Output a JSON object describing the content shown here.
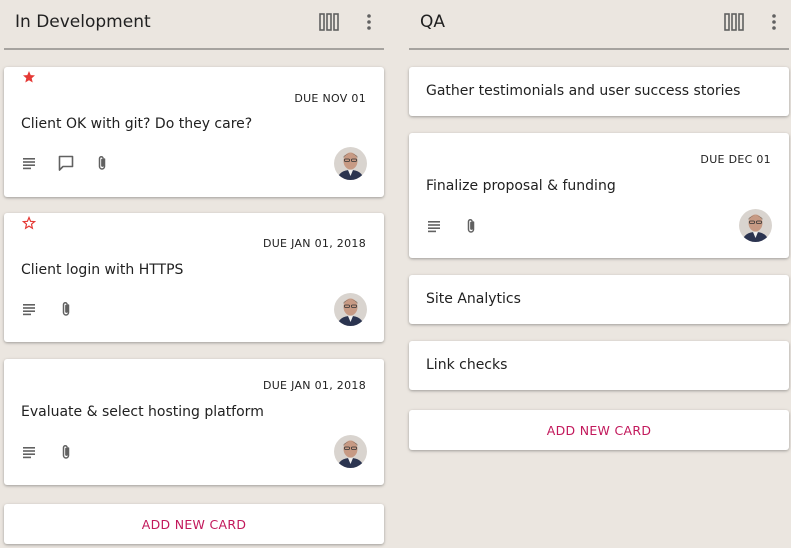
{
  "colors": {
    "background": "#ebe6e0",
    "accent": "#c2185b",
    "star": "#e53935",
    "icon": "#616161"
  },
  "columns": [
    {
      "title": "In Development",
      "cards": [
        {
          "starred": true,
          "due": "DUE NOV 01",
          "title": "Client OK with git? Do they care?",
          "icons": [
            "description-icon",
            "comment-icon",
            "attachment-icon"
          ]
        },
        {
          "starred": false,
          "due": "DUE JAN 01, 2018",
          "title": "Client login with HTTPS",
          "icons": [
            "description-icon",
            "attachment-icon"
          ]
        },
        {
          "due": "DUE JAN 01, 2018",
          "title": "Evaluate & select hosting platform",
          "icons": [
            "description-icon",
            "attachment-icon"
          ]
        }
      ],
      "add_label": "ADD NEW CARD"
    },
    {
      "title": "QA",
      "cards": [
        {
          "title": "Gather testimonials and user success stories"
        },
        {
          "due": "DUE DEC 01",
          "title": "Finalize proposal & funding",
          "icons": [
            "description-icon",
            "attachment-icon"
          ]
        },
        {
          "title": "Site Analytics"
        },
        {
          "title": "Link checks"
        }
      ],
      "add_label": "ADD NEW CARD"
    }
  ]
}
